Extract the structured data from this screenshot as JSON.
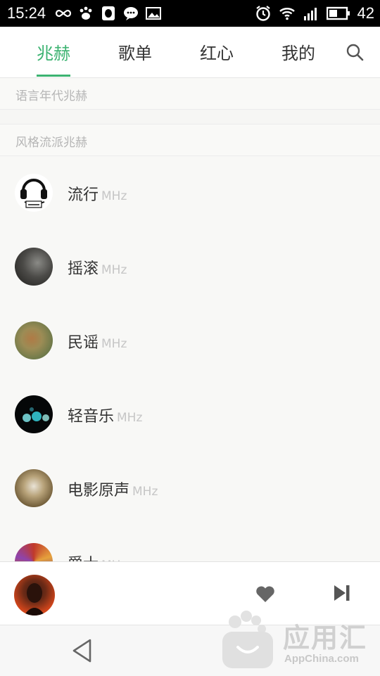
{
  "status_bar": {
    "time": "15:24",
    "battery": "42"
  },
  "tabs": [
    {
      "label": "兆赫",
      "active": true
    },
    {
      "label": "歌单",
      "active": false
    },
    {
      "label": "红心",
      "active": false
    },
    {
      "label": "我的",
      "active": false
    }
  ],
  "sections": {
    "language_era": "语言年代兆赫",
    "style_genre": "风格流派兆赫"
  },
  "channels": [
    {
      "name": "流行",
      "suffix": "MHz"
    },
    {
      "name": "摇滚",
      "suffix": "MHz"
    },
    {
      "name": "民谣",
      "suffix": "MHz"
    },
    {
      "name": "轻音乐",
      "suffix": "MHz"
    },
    {
      "name": "电影原声",
      "suffix": "MHz"
    },
    {
      "name": "爵士",
      "suffix": "MHz"
    }
  ],
  "watermark": {
    "text": "应用汇",
    "sub": "AppChina.com"
  },
  "colors": {
    "accent": "#3cb371",
    "status_bar": "#000000"
  }
}
